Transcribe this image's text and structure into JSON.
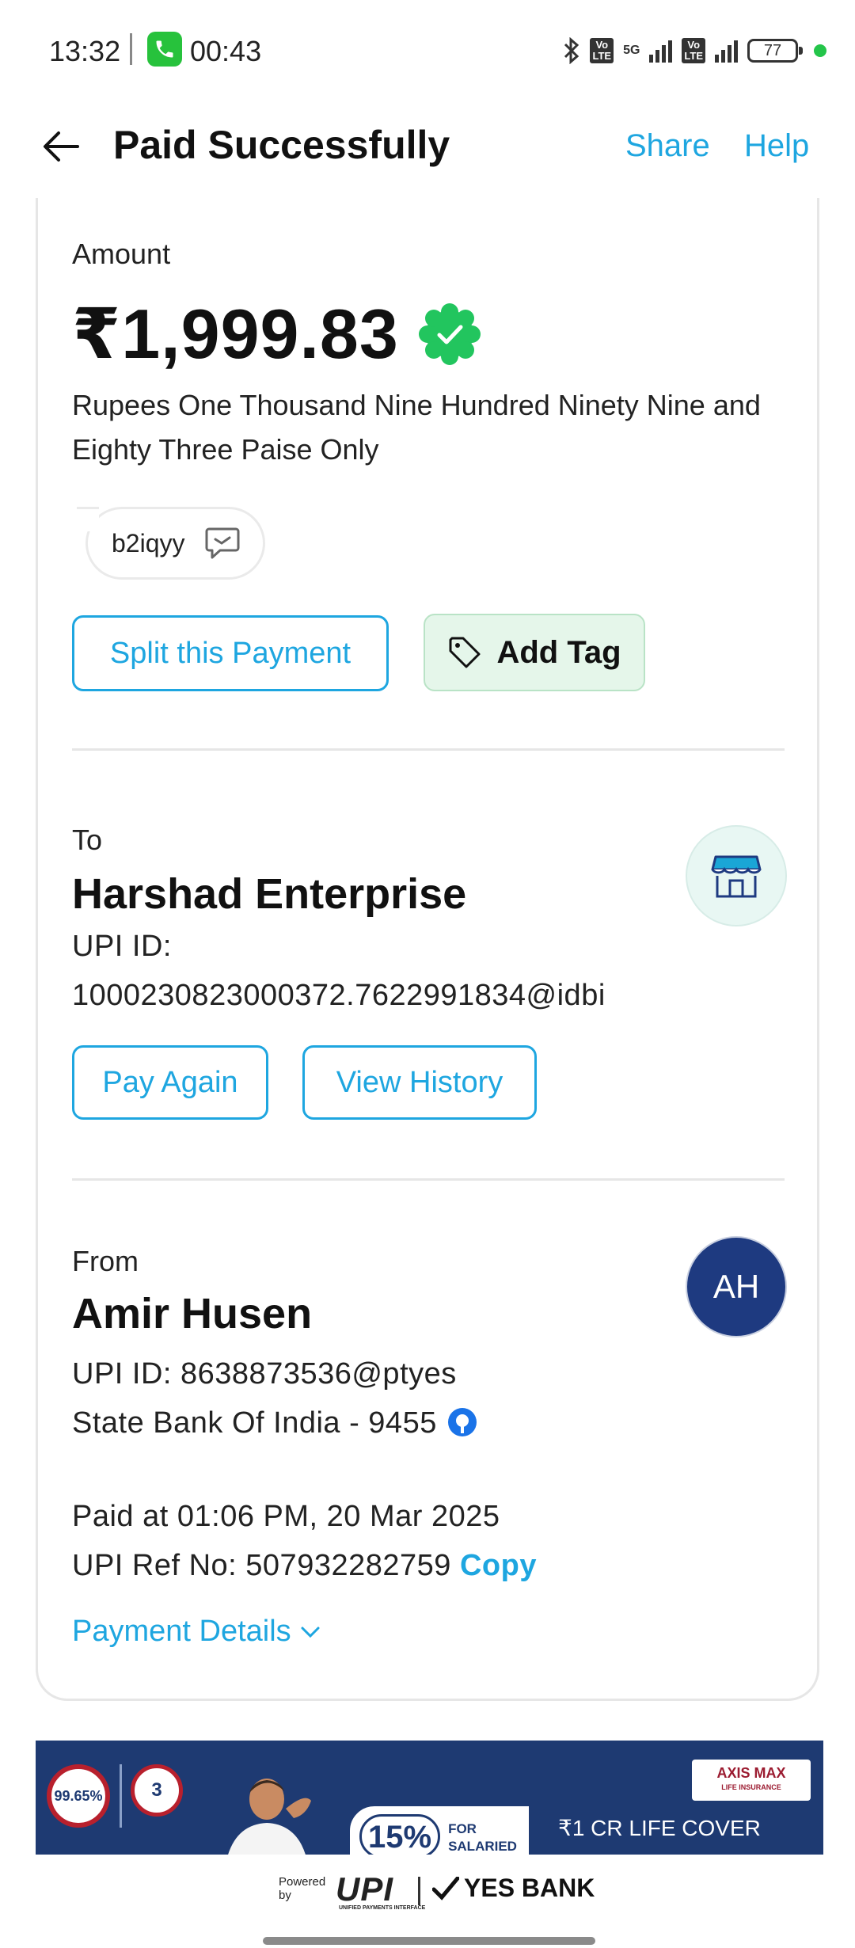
{
  "status_bar": {
    "time": "13:32",
    "call_timer": "00:43",
    "battery": "77",
    "network": "5G",
    "volte_label": "Vo LTE"
  },
  "header": {
    "title": "Paid Successfully",
    "share_label": "Share",
    "help_label": "Help"
  },
  "payment": {
    "amount_label": "Amount",
    "amount": "₹1,999.83",
    "amount_words": "Rupees One Thousand Nine Hundred Ninety Nine and Eighty Three Paise Only",
    "note": "b2iqyy",
    "split_label": "Split this Payment",
    "add_tag_label": "Add Tag"
  },
  "recipient": {
    "section_label": "To",
    "name": "Harshad Enterprise",
    "upi_label": "UPI ID:",
    "upi_id": "1000230823000372.7622991834@idbi",
    "pay_again_label": "Pay Again",
    "view_history_label": "View History"
  },
  "sender": {
    "section_label": "From",
    "name": "Amir Husen",
    "initials": "AH",
    "upi_line": "UPI ID: 8638873536@ptyes",
    "bank_line": "State Bank Of India - 9455"
  },
  "transaction": {
    "paid_at": "Paid at 01:06 PM, 20 Mar 2025",
    "ref_line": "UPI Ref No: 507932282759",
    "copy_label": "Copy",
    "details_label": "Payment Details"
  },
  "ad": {
    "seal_1": "99.65%",
    "seal_2": "3",
    "discount": "15%",
    "discount_sub_1": "FOR",
    "discount_sub_2": "SALARIED",
    "brand": "AXIS MAX",
    "brand_sub": "LIFE INSURANCE",
    "cover_text": "₹1 CR LIFE COVER"
  },
  "footer": {
    "powered_by": "Powered by",
    "upi": "UPI",
    "upi_sub": "UNIFIED PAYMENTS INTERFACE",
    "bank": "YES BANK"
  },
  "colors": {
    "accent": "#1ea6e0",
    "verified_green": "#22c55e",
    "tag_bg": "#e5f6ea",
    "avatar_bg": "#1e3a80",
    "ad_bg": "#1e3a72"
  }
}
